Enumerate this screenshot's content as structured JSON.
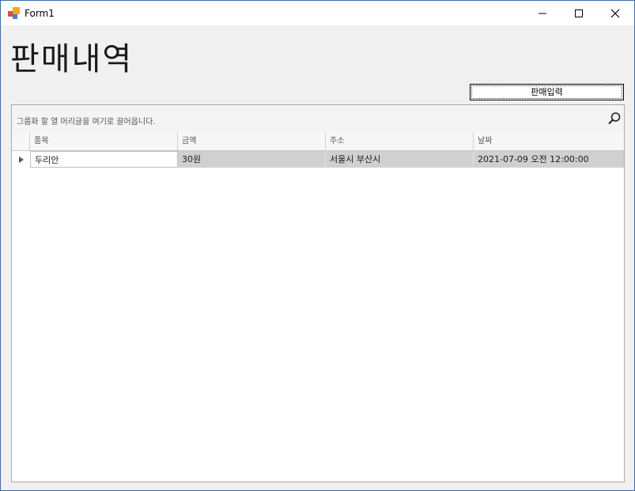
{
  "window": {
    "title": "Form1",
    "controls": {
      "minimize": "minimize-icon",
      "maximize": "maximize-icon",
      "close": "close-icon"
    }
  },
  "page": {
    "title": "판매내역",
    "action_button_label": "판매입력"
  },
  "grid": {
    "group_panel_hint": "그룹화 할 열 머리글을 여기로 끌어옵니다.",
    "columns": [
      "품목",
      "금액",
      "주소",
      "날짜"
    ],
    "rows": [
      [
        "두리안",
        "30원",
        "서울시 부산시",
        "2021-07-09 오전 12:00:00"
      ]
    ]
  },
  "colors": {
    "window_border": "#3a6ea5",
    "selected_row": "#d0d0d0",
    "background": "#f0f0f0"
  }
}
